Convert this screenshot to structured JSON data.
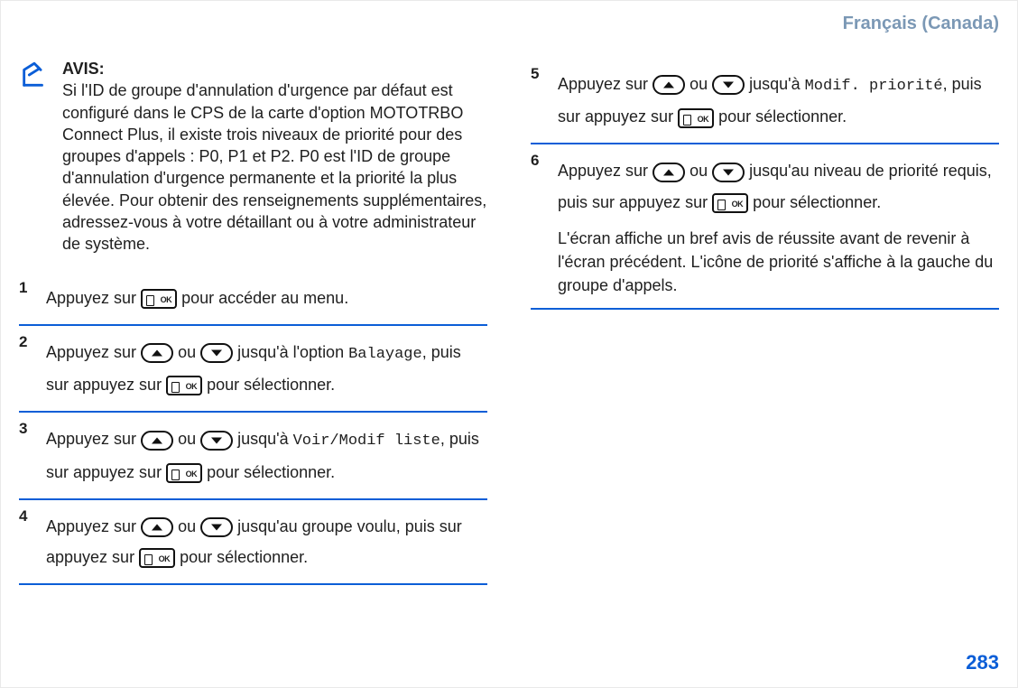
{
  "header": {
    "locale_label": "Français (Canada)"
  },
  "notice": {
    "title": "AVIS:",
    "body": "Si l'ID de groupe d'annulation d'urgence par défaut est configuré dans le CPS de la carte d'option MOTOTRBO Connect Plus, il existe trois niveaux de priorité pour des groupes d'appels : P0, P1 et P2. P0 est l'ID de groupe d'annulation d'urgence permanente et la priorité la plus élevée. Pour obtenir des renseignements supplémentaires, adressez-vous à votre détaillant ou à votre administrateur de système."
  },
  "icon_label": {
    "ok": "OK"
  },
  "steps_left": {
    "s1": {
      "t1": "Appuyez sur ",
      "t2": " pour accéder au menu."
    },
    "s2": {
      "t1": "Appuyez sur ",
      "t2": " ou ",
      "t3": " jusqu'à l'option ",
      "code1": "Balayage",
      "t4": ", puis sur appuyez sur ",
      "t5": " pour sélectionner."
    },
    "s3": {
      "t1": "Appuyez sur ",
      "t2": " ou ",
      "t3": " jusqu'à ",
      "code1": "Voir/Modif liste",
      "t4": ", puis sur appuyez sur ",
      "t5": " pour sélectionner."
    },
    "s4": {
      "t1": "Appuyez sur ",
      "t2": " ou ",
      "t3": " jusqu'au groupe voulu, puis sur appuyez sur ",
      "t4": " pour sélectionner."
    }
  },
  "steps_right": {
    "s5": {
      "t1": "Appuyez sur ",
      "t2": " ou ",
      "t3": " jusqu'à ",
      "code1": "Modif. priorité",
      "t4": ", puis sur appuyez sur ",
      "t5": " pour sélectionner."
    },
    "s6": {
      "t1": "Appuyez sur ",
      "t2": " ou ",
      "t3": " jusqu'au niveau de priorité requis, puis sur appuyez sur ",
      "t4": " pour sélectionner.",
      "extra": "L'écran affiche un bref avis de réussite avant de revenir à l'écran précédent. L'icône de priorité s'affiche à la gauche du groupe d'appels."
    }
  },
  "page_number": "283"
}
